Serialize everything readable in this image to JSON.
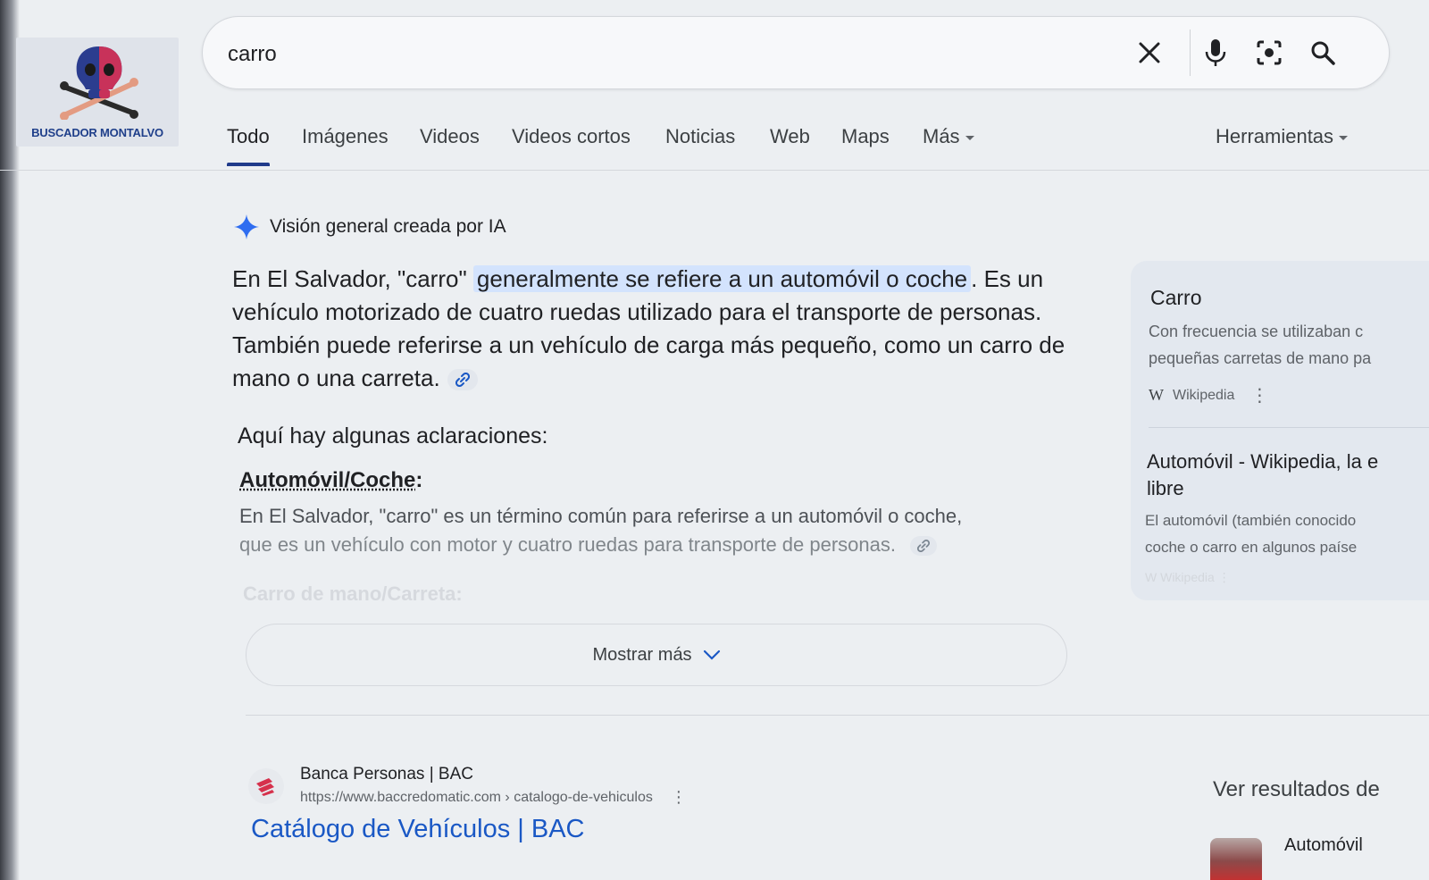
{
  "logo": {
    "text": "BUSCADOR MONTALVO"
  },
  "search": {
    "query": "carro"
  },
  "tabs": [
    {
      "label": "Todo"
    },
    {
      "label": "Imágenes"
    },
    {
      "label": "Videos"
    },
    {
      "label": "Videos cortos"
    },
    {
      "label": "Noticias"
    },
    {
      "label": "Web"
    },
    {
      "label": "Maps"
    },
    {
      "label": "Más"
    }
  ],
  "tools_label": "Herramientas",
  "ai_overview": {
    "heading": "Visión general creada por IA",
    "para_before": "En El Salvador, \"carro\" ",
    "para_highlight": "generalmente se refiere a un automóvil o coche",
    "para_after": ". Es un vehículo motorizado de cuatro ruedas utilizado para el transporte de personas. También puede referirse a un vehículo de carga más pequeño, como un carro de mano o una carreta.",
    "sub_heading": "Aquí hay algunas aclaraciones:",
    "item_title": "Automóvil/Coche",
    "item_title_suffix": ":",
    "item_text_1": "En El Salvador, \"carro\" es un término común para referirse a un automóvil o coche,",
    "item_text_2": "que es un vehículo con motor y cuatro ruedas para transporte de personas.",
    "faded_next": "Carro de mano/Carreta:",
    "show_more": "Mostrar más"
  },
  "sources": [
    {
      "title": "Carro",
      "line1": "Con frecuencia se utilizaban c",
      "line2": "pequeñas carretas de mano pa",
      "site": "Wikipedia"
    },
    {
      "title_line1": "Automóvil - Wikipedia, la e",
      "title_line2": "libre",
      "line1": "El automóvil (también conocido",
      "line2": "coche o carro en algunos paíse",
      "site": "Wikipedia"
    }
  ],
  "result": {
    "site_name": "Banca Personas | BAC",
    "url": "https://www.baccredomatic.com › catalogo-de-vehiculos",
    "title": "Catálogo de Vehículos | BAC"
  },
  "side_results": {
    "heading": "Ver resultados de",
    "item": "Automóvil"
  },
  "colors": {
    "accent_blue": "#1f3a8a",
    "link_blue": "#1a58c5",
    "highlight": "#d3e3fd"
  }
}
